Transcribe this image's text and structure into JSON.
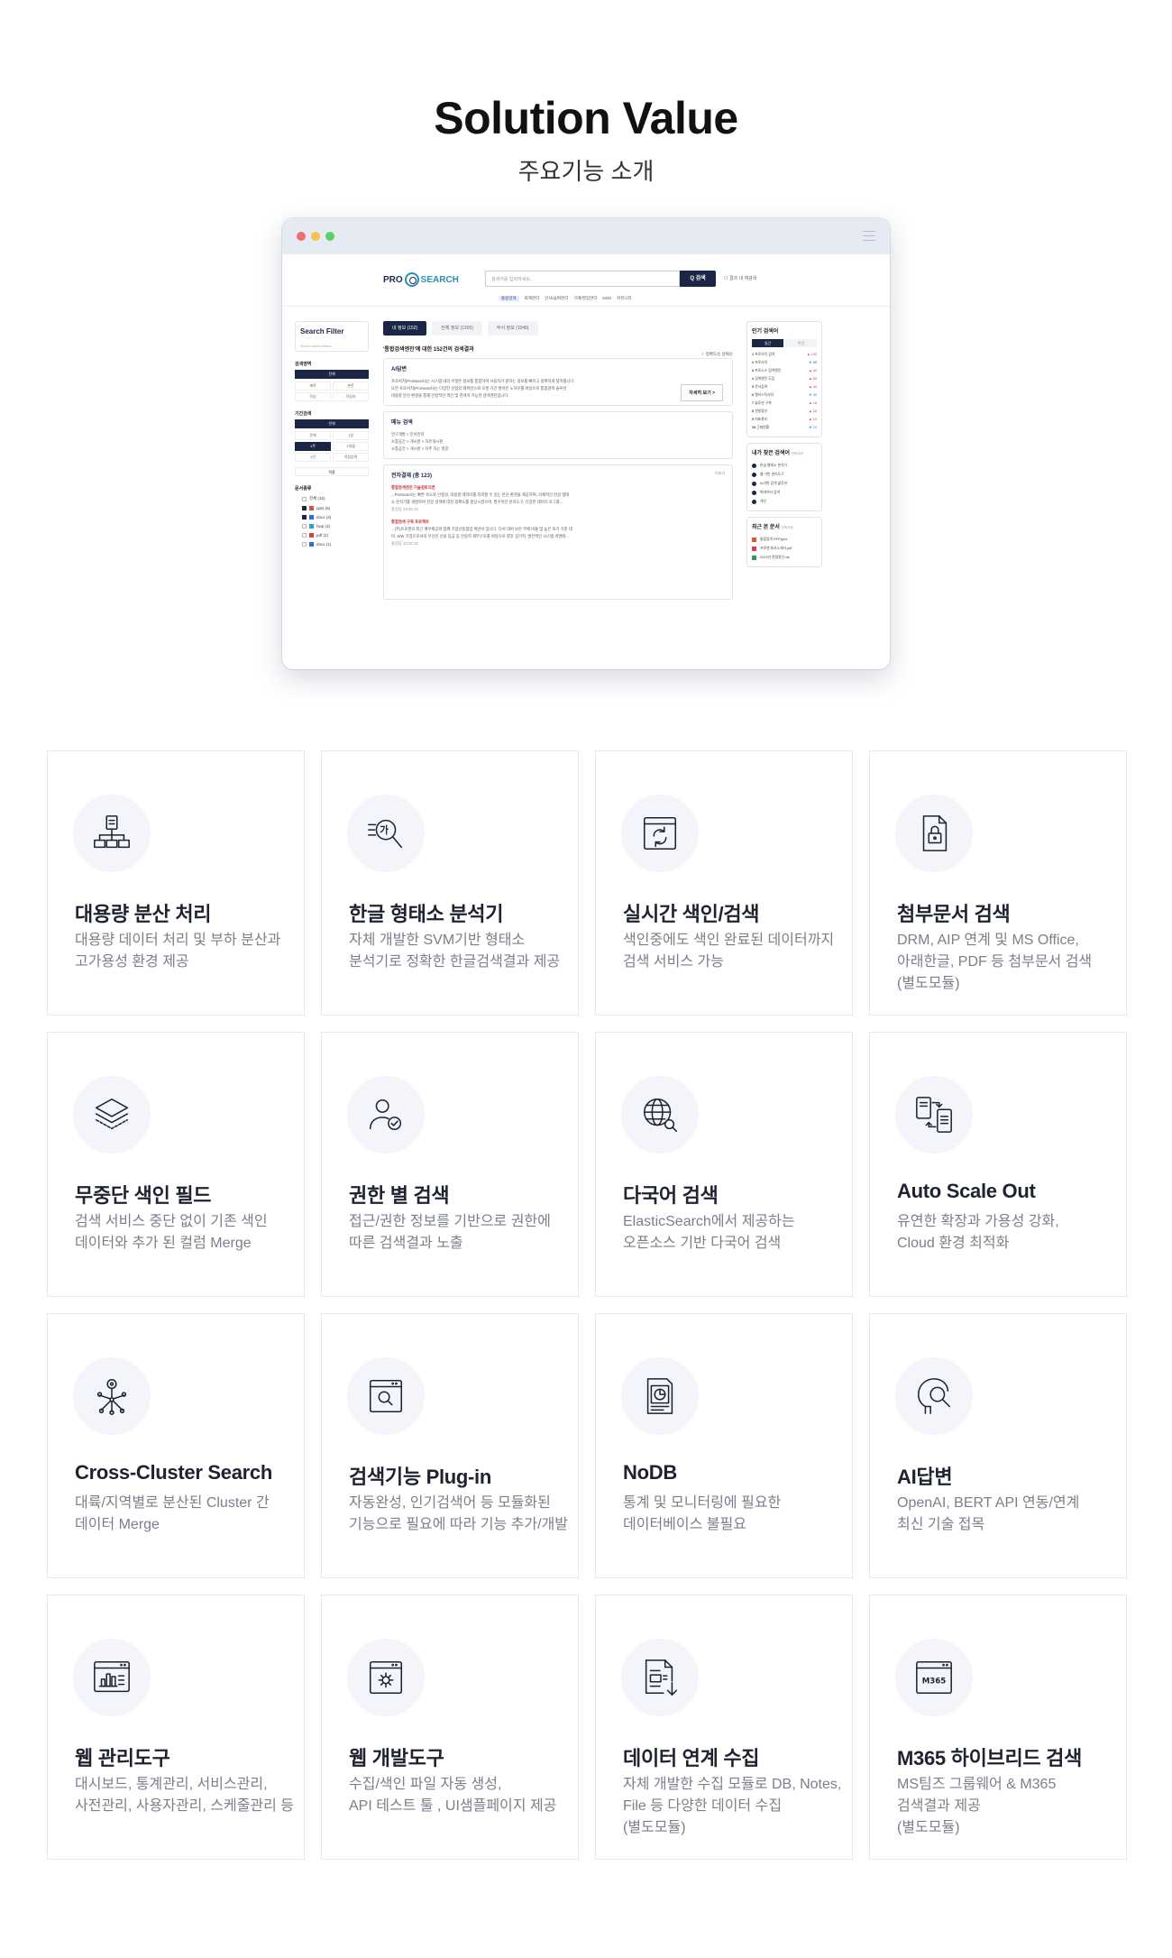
{
  "hero": {
    "title": "Solution Value",
    "subtitle": "주요기능 소개"
  },
  "mockup": {
    "logo_pro": "PRO",
    "logo_search": "SEARCH",
    "search_placeholder": "검색어를 입력하세요.",
    "search_button": "Q 검색",
    "search_checkbox": "결과 내 재검색",
    "nav": [
      "통합검색",
      "회계관리",
      "인사/급여관리",
      "구매/영업관리",
      "KMS",
      "커뮤니티"
    ],
    "sidebar": {
      "title": "Search Filter",
      "subtitle": "Set the search criteria",
      "section_area": "검색영역",
      "area_all": "전체",
      "area_opts": [
        "제목",
        "본문",
        "작성",
        "작성자"
      ],
      "section_period": "기간검색",
      "period_all": "전체",
      "period_opts": [
        "전체",
        "1일",
        "1주",
        "1개월",
        "1년",
        "직접입력"
      ],
      "apply": "적용",
      "section_doc": "문서종류",
      "doc_types": [
        {
          "label": "전체 (15)",
          "on": false,
          "color": ""
        },
        {
          "label": "pptx (5)",
          "on": true,
          "color": "#e0533a"
        },
        {
          "label": "docx (4)",
          "on": true,
          "color": "#2f6fd6"
        },
        {
          "label": "hwp (3)",
          "on": false,
          "color": "#2aa2c9"
        },
        {
          "label": "pdf (2)",
          "on": false,
          "color": "#d94040"
        },
        {
          "label": "docx (1)",
          "on": false,
          "color": "#2f6fd6"
        }
      ]
    },
    "tabs": [
      "내 정보 (152)",
      "전체 정보 (1200)",
      "부서 정보 (1048)"
    ],
    "result_line": "'통합검색엔진'에 대한 152건의 검색결과",
    "result_sort": "✓ 정확도순   날짜순",
    "ai_card": {
      "title": "AI답변",
      "line1": "프로서치(ProSearch)는 시스템 내의 수많은 정보를 통합하여 사용자가 원하는 정보를 빠르고 정확하게 찾아줍니다.",
      "line2": "또한 프로서치(ProSearch)는 다양한 산업의 레퍼런스와 오랜 기간 쌓아온 노하우를 바탕으로 통합검색 솔루션",
      "line3": "대용량 분산 환경을 통해 안정적인 색인 및 검색이 가능한 검색엔진입니다.",
      "more": "자세히 보기 >"
    },
    "menu_card": {
      "title": "메뉴 검색",
      "lines": [
        "연구개발 > 문서관리",
        "소통공간 > 게시판 > 자유게시판",
        "소통공간 > 게시판 > 자주 하는 질문"
      ]
    },
    "docs_card": {
      "title": "전자결재 (총 123)",
      "more": "더보기",
      "item1_title": "통합검색엔진 기술검토의견",
      "item1_l1": "...ProSearch는 빠른 속도와 안정성, 대용량 데이터를 처리할 수 있는 분산 환경을 제공하며, 자체적인 한글 형태",
      "item1_l2": "소 분석기를 개발하여 한글 검색에 대한 정확도를 향상시켰으며, 필수적인 관리도구, 다양한 데이터 로그를...",
      "item1_meta": "홍길동    23.06.18",
      "item2_title": "통합검색 구축 프로젝트",
      "item2_l1": "...(주)프로젠의 최근 매우제공와 함께 기업산동협업 위반서 입니다. 다서 대비 보안 부패 비율 및 높은 처기 기준 대",
      "item2_l2": "비, S/W 기업으로서의 우선진 신용 등급 등 안정적 재무구조를 바탕으로 향후 장기적, 발전적인 시스템 개발에...",
      "item2_meta": "홍길동    23.06.18"
    },
    "popular": {
      "title": "인기 검색어",
      "tab_on": "일간",
      "tab_off": "주간",
      "items": [
        {
          "n": "1",
          "t": "프로서치 검색",
          "d": "▲ 192",
          "up": true
        },
        {
          "n": "2",
          "t": "프로서치",
          "d": "▼ 88",
          "up": false
        },
        {
          "n": "3",
          "t": "프로소스 검색엔진",
          "d": "▲ 42",
          "up": true
        },
        {
          "n": "4",
          "t": "검색엔진 도입",
          "d": "▲ 53",
          "up": true
        },
        {
          "n": "5",
          "t": "문서검색",
          "d": "▲ 43",
          "up": true
        },
        {
          "n": "6",
          "t": "엘라스틱서치",
          "d": "▼ 32",
          "up": false
        },
        {
          "n": "7",
          "t": "솔루션 구축",
          "d": "▲ 18",
          "up": true
        },
        {
          "n": "8",
          "t": "연말정산",
          "d": "▲ 16",
          "up": true
        },
        {
          "n": "9",
          "t": "지표관리",
          "d": "▲ 13",
          "up": true
        },
        {
          "n": "10",
          "t": "근태현황",
          "d": "▼ 12",
          "up": false
        }
      ]
    },
    "my_search": {
      "title": "내가 찾은 검색어",
      "del": "전체삭제",
      "items": [
        "한글 형태소 분석기",
        "웹 기반 관리도구",
        "AI기반 검색 솔루션",
        "빅데이터 검색",
        "색인"
      ]
    },
    "recent_docs": {
      "title": "최근 본 문서",
      "del": "전체삭제",
      "items": [
        {
          "t": "통합검색 RFP.pptx",
          "c": "#e0533a"
        },
        {
          "t": "프로젠 회사소개서.pdf",
          "c": "#d94040"
        },
        {
          "t": "2023년 연말정산.xls",
          "c": "#2c9a54"
        }
      ]
    }
  },
  "features": [
    {
      "icon": "distributed-server-icon",
      "title": "대용량 분산 처리",
      "desc": "대용량 데이터 처리 및 부하 분산과\n고가용성 환경 제공"
    },
    {
      "icon": "hangul-search-icon",
      "title": "한글 형태소 분석기",
      "desc": "자체 개발한 SVM기반 형태소\n분석기로 정확한 한글검색결과 제공"
    },
    {
      "icon": "realtime-sync-icon",
      "title": "실시간 색인/검색",
      "desc": "색인중에도 색인 완료된 데이터까지\n검색 서비스 가능"
    },
    {
      "icon": "locked-document-icon",
      "title": "첨부문서 검색",
      "desc": "DRM, AIP 연계 및 MS Office,\n아래한글, PDF 등 첨부문서 검색\n(별도모듈)"
    },
    {
      "icon": "layers-icon",
      "title": "무중단 색인 필드",
      "desc": "검색 서비스 중단 없이 기존 색인\n데이터와 추가 된 컬럼 Merge"
    },
    {
      "icon": "user-check-icon",
      "title": "권한 별 검색",
      "desc": "접근/권한 정보를 기반으로 권한에\n따른 검색결과 노출"
    },
    {
      "icon": "globe-search-icon",
      "title": "다국어 검색",
      "desc": "ElasticSearch에서 제공하는\n오픈소스 기반 다국어 검색"
    },
    {
      "icon": "devices-sync-icon",
      "title": "Auto Scale Out",
      "desc": "유연한 확장과 가용성 강화,\nCloud 환경 최적화"
    },
    {
      "icon": "cluster-nodes-icon",
      "title": "Cross-Cluster Search",
      "desc": "대륙/지역별로 분산된 Cluster 간\n데이터 Merge"
    },
    {
      "icon": "browser-search-icon",
      "title": "검색기능 Plug-in",
      "desc": "자동완성, 인기검색어 등 모듈화된\n기능으로 필요에 따라 기능 추가/개발"
    },
    {
      "icon": "document-chart-icon",
      "title": "NoDB",
      "desc": "통계 및 모니터링에 필요한\n데이터베이스 불필요"
    },
    {
      "icon": "ai-head-search-icon",
      "title": "AI답변",
      "desc": "OpenAI, BERT API 연동/연계\n최신 기술 접목"
    },
    {
      "icon": "dashboard-chart-icon",
      "title": "웹 관리도구",
      "desc": "대시보드, 통계관리, 서비스관리,\n사전관리, 사용자관리, 스케줄관리 등"
    },
    {
      "icon": "browser-gear-icon",
      "title": "웹 개발도구",
      "desc": "수집/색인 파일 자동 생성,\nAPI 테스트 툴 , UI샘플페이지 제공"
    },
    {
      "icon": "document-download-icon",
      "title": "데이터 연계 수집",
      "desc": "자체 개발한 수집 모듈로 DB, Notes,\nFile 등 다양한 데이터 수집\n(별도모듈)"
    },
    {
      "icon": "m365-window-icon",
      "title": "M365 하이브리드 검색",
      "desc": "MS팀즈 그룹웨어 & M365\n검색결과 제공\n(별도모듈)",
      "icon_text": "M365"
    }
  ]
}
